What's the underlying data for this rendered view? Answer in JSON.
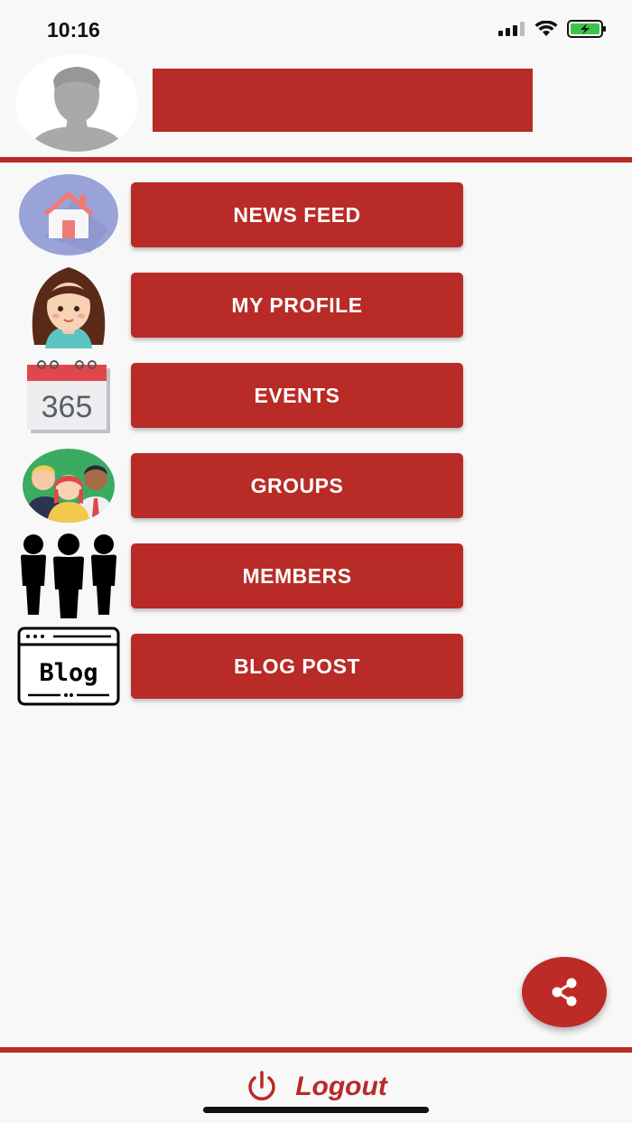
{
  "status_bar": {
    "time": "10:16"
  },
  "colors": {
    "accent": "#b82b26",
    "background": "#f8f8f9"
  },
  "header": {
    "avatar_icon": "user-silhouette-icon",
    "name_bar_text": ""
  },
  "menu": {
    "items": [
      {
        "label": "NEWS FEED",
        "icon": "home-icon"
      },
      {
        "label": "MY PROFILE",
        "icon": "girl-avatar-icon"
      },
      {
        "label": "EVENTS",
        "icon": "calendar-365-icon"
      },
      {
        "label": "GROUPS",
        "icon": "group-people-icon"
      },
      {
        "label": "MEMBERS",
        "icon": "members-silhouette-icon"
      },
      {
        "label": "BLOG POST",
        "icon": "blog-icon"
      }
    ]
  },
  "fab": {
    "icon": "share-icon"
  },
  "footer": {
    "logout_label": "Logout",
    "logout_icon": "power-icon"
  },
  "calendar_text": "365",
  "blog_text": "Blog"
}
